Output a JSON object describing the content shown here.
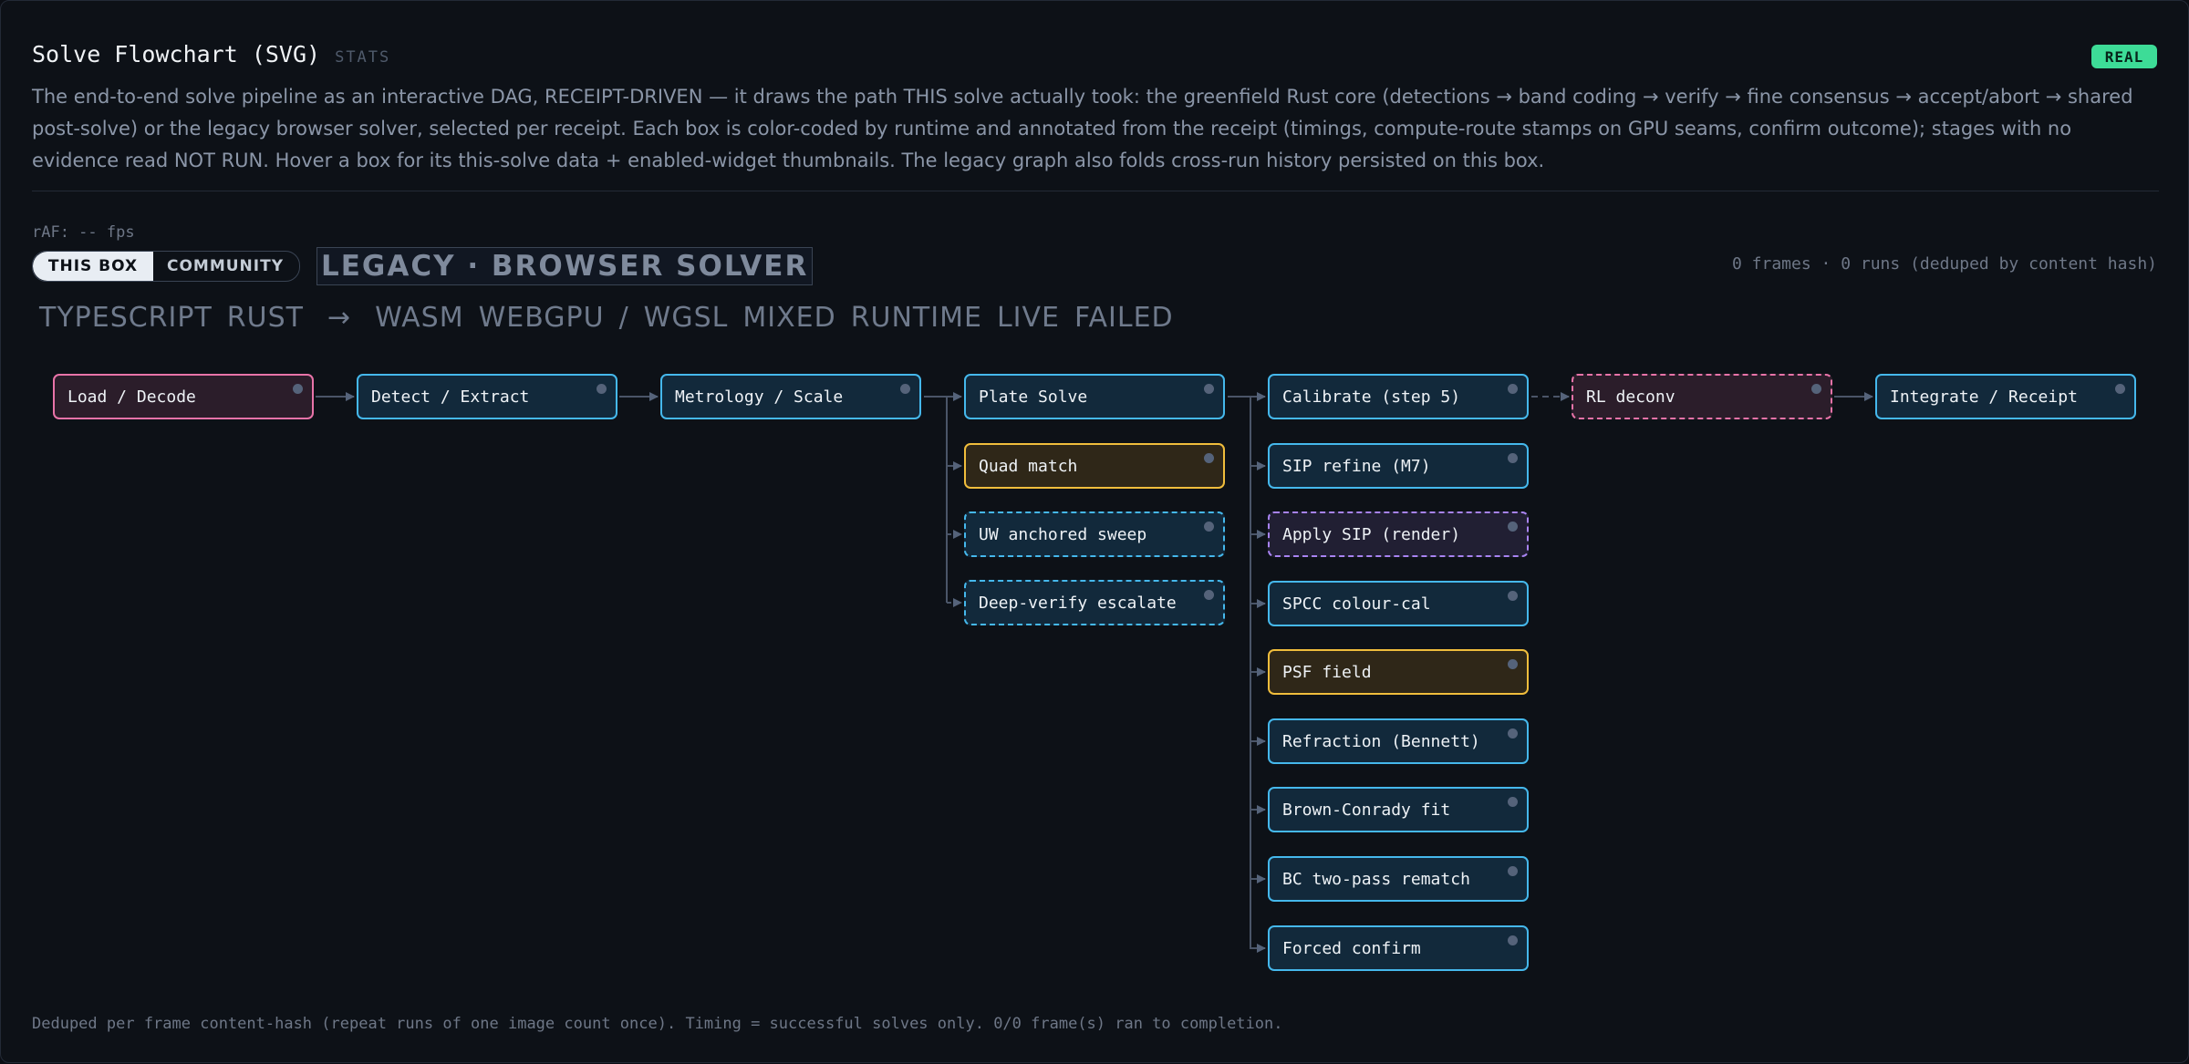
{
  "header": {
    "title": "Solve Flowchart (SVG)",
    "tag": "STATS",
    "badge": "REAL",
    "description": "The end-to-end solve pipeline as an interactive DAG, RECEIPT-DRIVEN — it draws the path THIS solve actually took: the greenfield Rust core (detections → band coding → verify → fine consensus → accept/abort → shared post-solve) or the legacy browser solver, selected per receipt. Each box is color-coded by runtime and annotated from the receipt (timings, compute-route stamps on GPU seams, confirm outcome); stages with no evidence read NOT RUN. Hover a box for its this-solve data + enabled-widget thumbnails. The legacy graph also folds cross-run history persisted on this box."
  },
  "raf": "rAF: -- fps",
  "toggle": {
    "this_box": "THIS BOX",
    "community": "COMMUNITY"
  },
  "solver_title": "LEGACY · BROWSER SOLVER",
  "runs_summary": "0 frames · 0 runs (deduped by content hash)",
  "legend": {
    "typescript": "TYPESCRIPT",
    "rust": "RUST",
    "arrow": "→",
    "wasm": "WASM",
    "webgpu": "WEBGPU",
    "slash": "/",
    "wgsl": "WGSL",
    "mixed": "MIXED",
    "runtime": "RUNTIME",
    "live": "LIVE",
    "failed": "FAILED"
  },
  "nodes": {
    "load": "Load / Decode",
    "detect": "Detect / Extract",
    "metrology": "Metrology / Scale",
    "plate": "Plate Solve",
    "quad": "Quad match",
    "uw": "UW anchored sweep",
    "deep": "Deep-verify escalate",
    "calibrate": "Calibrate (step 5)",
    "sip_refine": "SIP refine (M7)",
    "apply_sip": "Apply SIP (render)",
    "spcc": "SPCC colour-cal",
    "psf": "PSF field",
    "refraction": "Refraction (Bennett)",
    "brown": "Brown-Conrady fit",
    "bc": "BC two-pass rematch",
    "forced": "Forced confirm",
    "rl": "RL deconv",
    "integrate": "Integrate / Receipt"
  },
  "colors": {
    "rust": "#45b8ec",
    "typescript": "#e873a8",
    "wasm": "#f0bd3c",
    "webgpu": "#a883f2",
    "badge": "#3ddc97"
  },
  "footer": "Deduped per frame content-hash (repeat runs of one image count once). Timing = successful solves only. 0/0 frame(s) ran to completion."
}
